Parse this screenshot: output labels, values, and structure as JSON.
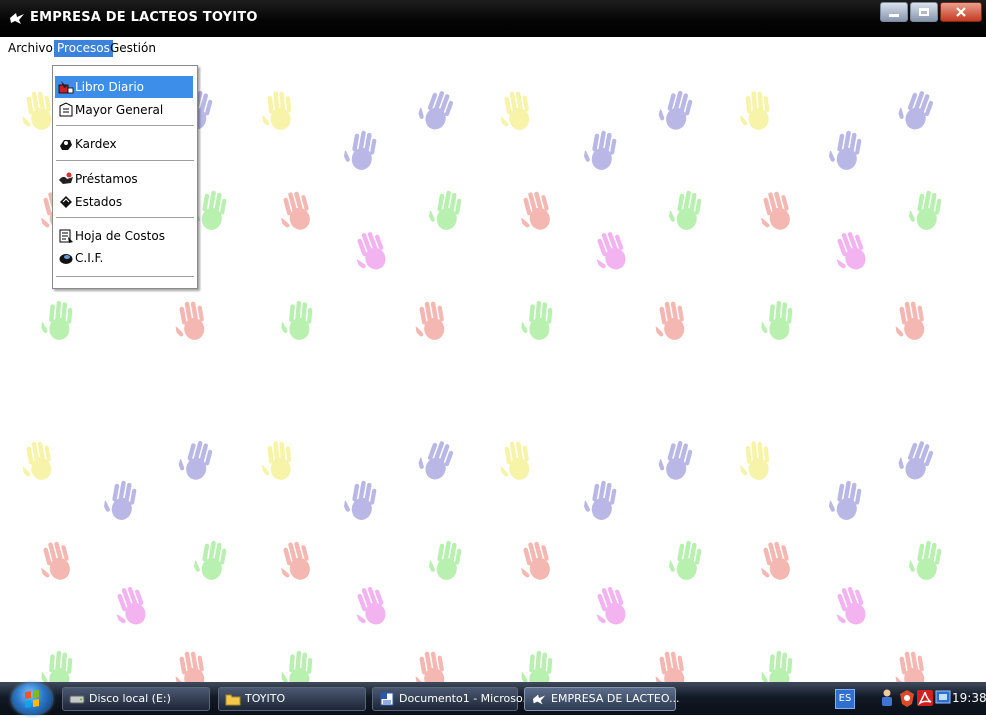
{
  "window": {
    "title": "EMPRESA DE LACTEOS TOYITO"
  },
  "menubar": {
    "items": [
      {
        "label": "Archivo"
      },
      {
        "label": "Procesos"
      },
      {
        "label": "Gestión"
      }
    ]
  },
  "dropdown": {
    "items": [
      {
        "label": "Libro Diario",
        "icon": "journal-icon"
      },
      {
        "label": "Mayor General",
        "icon": "ledger-icon"
      },
      {
        "label": "Kardex",
        "icon": "kardex-icon"
      },
      {
        "label": "Préstamos",
        "icon": "loans-icon"
      },
      {
        "label": "Estados",
        "icon": "statements-icon"
      },
      {
        "label": "Hoja de Costos",
        "icon": "cost-sheet-icon"
      },
      {
        "label": "C.I.F.",
        "icon": "cif-icon"
      }
    ],
    "selected": "Libro Diario"
  },
  "taskbar": {
    "tasks": [
      {
        "label": "Disco local (E:)",
        "icon": "drive-icon"
      },
      {
        "label": "TOYITO",
        "icon": "folder-icon"
      },
      {
        "label": "Documento1 - Microso...",
        "icon": "word-document-icon"
      },
      {
        "label": "EMPRESA DE LACTEO...",
        "icon": "app-icon"
      }
    ],
    "language": "ES",
    "clock": "19:38"
  },
  "colors": {
    "title_bar": "#000000",
    "menu_highlight": "#3a82dc",
    "hand_yellow": "#f7f3a8",
    "hand_blue": "#b9b7e6",
    "hand_green": "#b8f0b0",
    "hand_red": "#f5b7b1",
    "hand_pink": "#f3b3f0"
  }
}
